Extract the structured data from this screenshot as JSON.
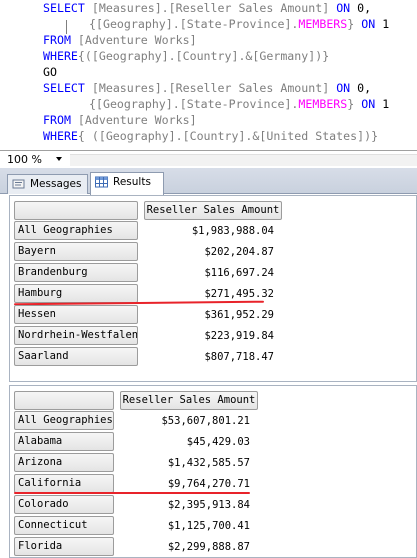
{
  "editor": {
    "lines": [
      {
        "select": "SELECT ",
        "text1": "[Measures].[Reseller Sales Amount] ",
        "on": "ON ",
        "num": "0,"
      },
      {
        "text1": "{[Geography].[State-Province].",
        "members": "MEMBERS",
        "close": "} ",
        "on": "ON ",
        "num": "1"
      },
      {
        "from": "FROM ",
        "text1": "[Adventure Works]"
      },
      {
        "where": "WHERE",
        "text1": "{([Geography].[Country].&[Germany])}"
      },
      {
        "go": "GO"
      },
      {
        "select": "SELECT ",
        "text1": "[Measures].[Reseller Sales Amount] ",
        "on": "ON ",
        "num": "0,"
      },
      {
        "text1": "{[Geography].[State-Province].",
        "members": "MEMBERS",
        "close": "} ",
        "on": "ON ",
        "num": "1"
      },
      {
        "from": "FROM ",
        "text1": "[Adventure Works]"
      },
      {
        "where": "WHERE",
        "text1": "{ ([Geography].[Country].&[United States])}"
      }
    ]
  },
  "zoom": {
    "value": "100 %"
  },
  "tabs": {
    "messages": "Messages",
    "results": "Results"
  },
  "result1": {
    "column_header": "Reseller Sales Amount",
    "rows": [
      {
        "label": "All Geographies",
        "value": "$1,983,988.04"
      },
      {
        "label": "Bayern",
        "value": "$202,204.87"
      },
      {
        "label": "Brandenburg",
        "value": "$116,697.24"
      },
      {
        "label": "Hamburg",
        "value": "$271,495.32"
      },
      {
        "label": "Hessen",
        "value": "$361,952.29"
      },
      {
        "label": "Nordrhein-Westfalen",
        "value": "$223,919.84"
      },
      {
        "label": "Saarland",
        "value": "$807,718.47"
      }
    ]
  },
  "result2": {
    "column_header": "Reseller Sales Amount",
    "rows": [
      {
        "label": "All Geographies",
        "value": "$53,607,801.21"
      },
      {
        "label": "Alabama",
        "value": "$45,429.03"
      },
      {
        "label": "Arizona",
        "value": "$1,432,585.57"
      },
      {
        "label": "California",
        "value": "$9,764,270.71"
      },
      {
        "label": "Colorado",
        "value": "$2,395,913.84"
      },
      {
        "label": "Connecticut",
        "value": "$1,125,700.41"
      },
      {
        "label": "Florida",
        "value": "$2,299,888.87"
      }
    ]
  },
  "colors": {
    "keyword": "#0000ff",
    "function": "#ff00ff",
    "annotation": "#e8232a"
  }
}
